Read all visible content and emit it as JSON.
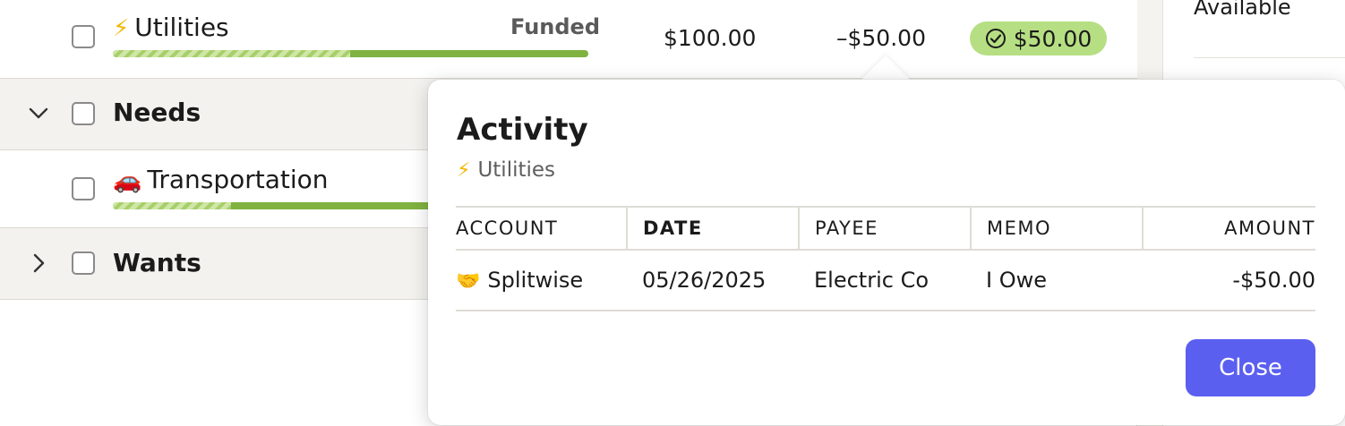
{
  "budget": {
    "utilities": {
      "icon": "⚡",
      "label": "Utilities",
      "status": "Funded",
      "assigned": "$100.00",
      "activity": "–$50.00",
      "available": "$50.00",
      "progress_funded_fraction": 0.5
    },
    "needs": {
      "label": "Needs"
    },
    "transportation": {
      "icon": "🚗",
      "label": "Transportation",
      "progress_funded_fraction": 0.26
    },
    "wants": {
      "label": "Wants"
    }
  },
  "side_panel": {
    "label": "Available"
  },
  "popover": {
    "title": "Activity",
    "subtitle_icon": "⚡",
    "subtitle": "Utilities",
    "columns": [
      "ACCOUNT",
      "DATE",
      "PAYEE",
      "MEMO",
      "AMOUNT"
    ],
    "rows": [
      {
        "account_icon": "🤝",
        "account": "Splitwise",
        "date": "05/26/2025",
        "payee": "Electric Co",
        "memo": "I Owe",
        "amount": "-$50.00"
      }
    ],
    "close_label": "Close"
  },
  "colors": {
    "accent": "#5b5ff0",
    "funded_pill": "#b6df83",
    "progress": "#7fb241"
  }
}
